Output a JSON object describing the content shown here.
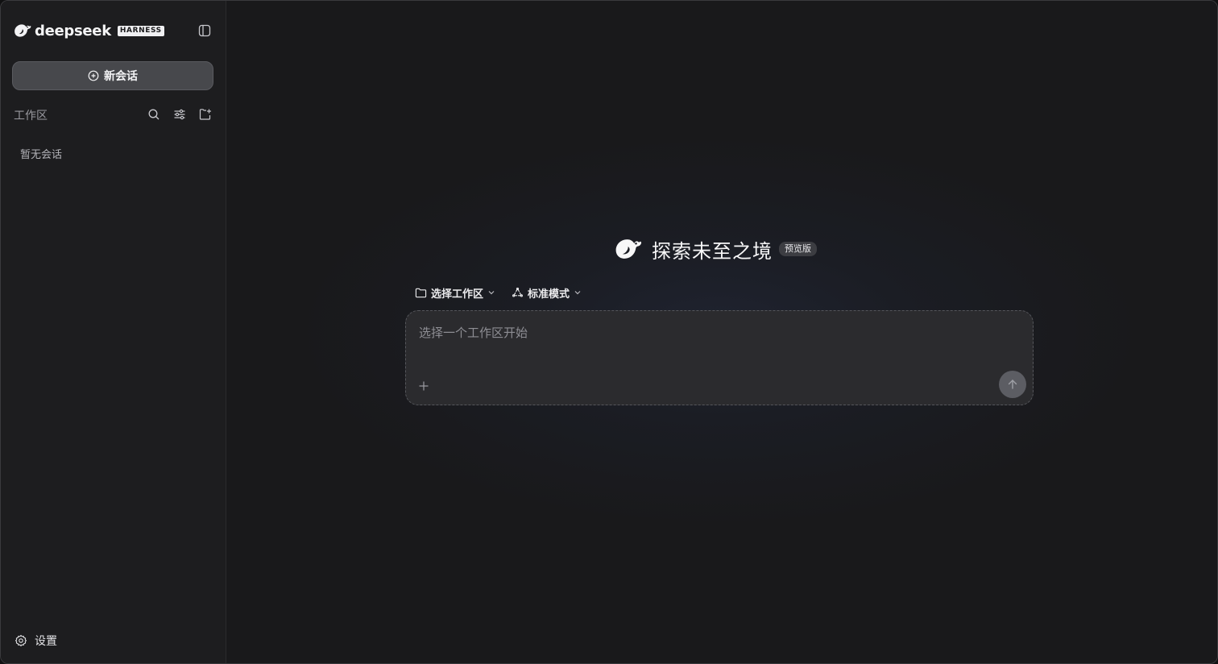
{
  "brand": {
    "wordmark": "deepseek",
    "tag": "HARNESS"
  },
  "sidebar": {
    "new_chat_label": "新会话",
    "workspace_label": "工作区",
    "empty_text": "暂无会话",
    "settings_label": "设置",
    "icons": [
      "sidebar-toggle-icon",
      "search-icon",
      "filter-icon",
      "new-folder-icon",
      "gear-icon"
    ]
  },
  "main": {
    "hero_title": "探索未至之境",
    "hero_badge": "预览版",
    "workspace_select_label": "选择工作区",
    "mode_select_label": "标准模式",
    "input_placeholder": "选择一个工作区开始",
    "icons": [
      "folder-icon",
      "mode-icon",
      "plus-icon",
      "send-arrow-icon"
    ]
  },
  "colors": {
    "background": "#19191b",
    "sidebar": "#1d1d1f",
    "new_chat_button": "#47484c",
    "composer": "#2b2b2e",
    "send_button": "#5c5d63"
  }
}
